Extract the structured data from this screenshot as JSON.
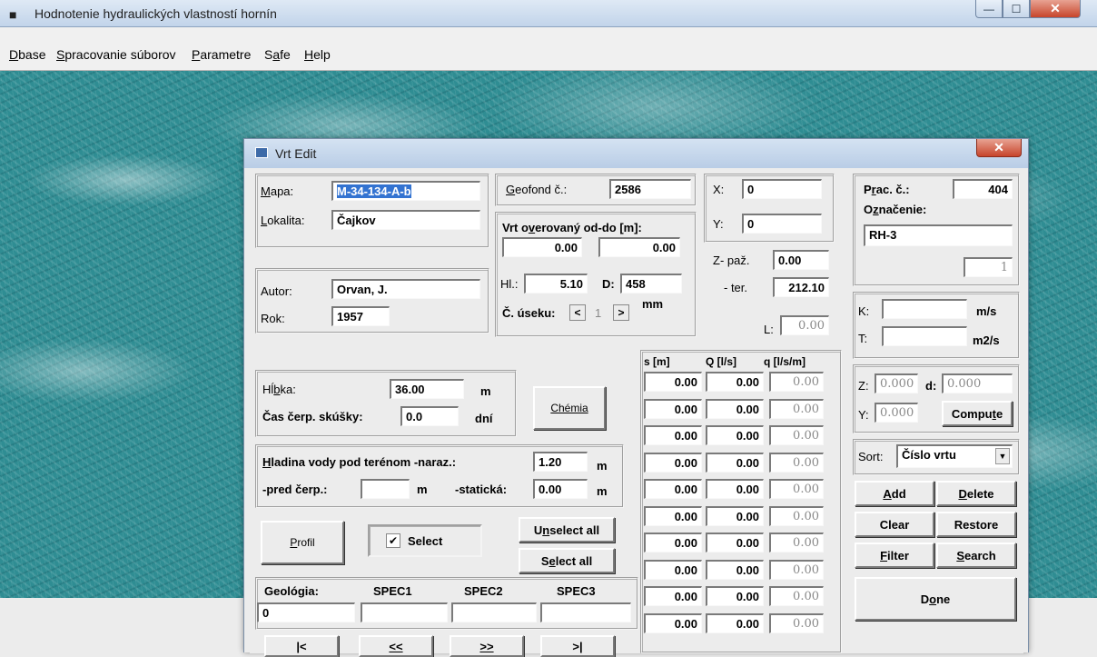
{
  "window": {
    "title": "Hodnotenie hydraulických vlastností hornín",
    "app_icon": "app-icon",
    "min_glyph": "—",
    "max_glyph": "☐",
    "close_glyph": "✕"
  },
  "menu": [
    {
      "accel": "D",
      "rest": "base"
    },
    {
      "accel": "S",
      "rest": "pracovanie súborov"
    },
    {
      "accel": "P",
      "rest": "arametre"
    },
    {
      "pre": "S",
      "accel": "a",
      "rest": "fe"
    },
    {
      "accel": "H",
      "rest": "elp"
    }
  ],
  "dialog": {
    "title": "Vrt Edit",
    "close_glyph": "✕",
    "mapa": {
      "label_accel": "M",
      "label_rest": "apa:",
      "value": "M-34-134-A-b"
    },
    "lokalita": {
      "label_accel": "L",
      "label_rest": "okalita:",
      "value": "Čajkov"
    },
    "autor": {
      "label": "Autor:",
      "value": "Orvan, J."
    },
    "rok": {
      "label": "Rok:",
      "value": "1957"
    },
    "geofond": {
      "label_accel": "G",
      "label_rest": "eofond č.:",
      "value": "2586"
    },
    "overovany": {
      "label_pre": "Vrt o",
      "label_accel": "v",
      "label_rest": "erovaný od-do [m]:",
      "od": "0.00",
      "do": "0.00"
    },
    "hl": {
      "label": "Hl.:",
      "value": "5.10"
    },
    "d": {
      "label": "D:",
      "value": "458",
      "unit": "mm"
    },
    "usek": {
      "label": "Č. úseku:",
      "prev": "<",
      "value": "1",
      "next": ">"
    },
    "x": {
      "label": "X:",
      "value": "0"
    },
    "y": {
      "label": "Y:",
      "value": "0"
    },
    "z_paz": {
      "label": "Z- paž.",
      "value": "0.00"
    },
    "ter": {
      "label": "- ter.",
      "value": "212.10"
    },
    "l": {
      "label": "L:",
      "value": "0.00"
    },
    "prac": {
      "label_pre": "P",
      "label_accel": "r",
      "label_rest": "ac. č.:",
      "value": "404"
    },
    "oznacenie": {
      "label_pre": "O",
      "label_accel": "z",
      "label_rest": "načenie:",
      "value": "RH-3",
      "index": "1"
    },
    "k": {
      "label": "K:",
      "value": "",
      "unit": "m/s"
    },
    "t": {
      "label": "T:",
      "value": "",
      "unit": "m2/s"
    },
    "hlbka": {
      "label_pre": "Hĺ",
      "label_accel": "b",
      "label_rest": "ka:",
      "value": "36.00",
      "unit": "m"
    },
    "cas": {
      "label": "Čas čerp. skúšky:",
      "value": "0.0",
      "unit": "dní"
    },
    "chemia_button": "Chémia",
    "hladina": {
      "label_accel": "H",
      "label_rest": "ladina vody pod terénom -naraz.:",
      "value": "1.20",
      "unit": "m"
    },
    "pred_cerp": {
      "label": "-pred čerp.:",
      "value": "",
      "unit": "m"
    },
    "staticka": {
      "label": "-statická:",
      "value": "0.00",
      "unit": "m"
    },
    "profil_button": {
      "accel": "P",
      "rest": "rofil"
    },
    "select_checkbox": {
      "check": "✔",
      "label": "Select"
    },
    "unselect_all": {
      "pre": "U",
      "accel": "n",
      "rest": "select all"
    },
    "select_all": {
      "pre": "S",
      "accel": "e",
      "rest": "lect all"
    },
    "geologia": {
      "label": "Geológia:",
      "value": "0"
    },
    "spec": [
      {
        "label": "SPEC1",
        "value": ""
      },
      {
        "label": "SPEC2",
        "value": ""
      },
      {
        "label": "SPEC3",
        "value": ""
      }
    ],
    "nav": {
      "first": "|<",
      "prev": "<<",
      "next": ">>",
      "last": ">|"
    },
    "table": {
      "headers": [
        "s [m]",
        "Q [l/s]",
        "q [l/s/m]"
      ],
      "rows": [
        [
          "0.00",
          "0.00",
          "0.00"
        ],
        [
          "0.00",
          "0.00",
          "0.00"
        ],
        [
          "0.00",
          "0.00",
          "0.00"
        ],
        [
          "0.00",
          "0.00",
          "0.00"
        ],
        [
          "0.00",
          "0.00",
          "0.00"
        ],
        [
          "0.00",
          "0.00",
          "0.00"
        ],
        [
          "0.00",
          "0.00",
          "0.00"
        ],
        [
          "0.00",
          "0.00",
          "0.00"
        ],
        [
          "0.00",
          "0.00",
          "0.00"
        ],
        [
          "0.00",
          "0.00",
          "0.00"
        ]
      ]
    },
    "zd": {
      "z_label": "Z:",
      "z_value": "0.000",
      "d_label": "d:",
      "d_value": "0.000"
    },
    "yc": {
      "y_label": "Y:",
      "y_value": "0.000",
      "compute_pre": "Compu",
      "compute_accel": "t",
      "compute_rest": "e"
    },
    "sort": {
      "label": "Sort:",
      "value": "Číslo vrtu",
      "arrow": "▼"
    },
    "buttons": {
      "add": {
        "accel": "A",
        "rest": "dd"
      },
      "delete": {
        "accel": "D",
        "rest": "elete"
      },
      "clear": {
        "label": "Clear"
      },
      "restore": {
        "label": "Restore"
      },
      "filter": {
        "accel": "F",
        "rest": "ilter"
      },
      "search": {
        "accel": "S",
        "rest": "earch"
      },
      "done": {
        "pre": "D",
        "accel": "o",
        "rest": "ne"
      }
    }
  }
}
